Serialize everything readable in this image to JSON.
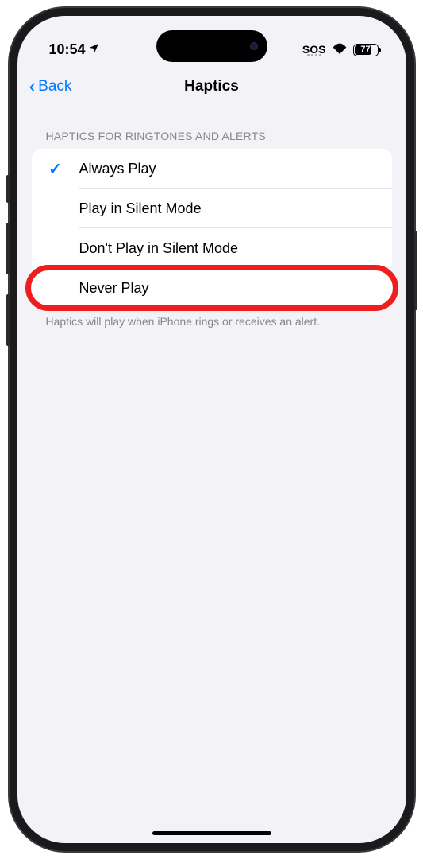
{
  "status": {
    "time": "10:54",
    "sos": "SOS",
    "battery": "77"
  },
  "nav": {
    "back": "Back",
    "title": "Haptics"
  },
  "section": {
    "header": "HAPTICS FOR RINGTONES AND ALERTS",
    "footer": "Haptics will play when iPhone rings or receives an alert."
  },
  "options": {
    "always": "Always Play",
    "silent": "Play in Silent Mode",
    "nosilent": "Don't Play in Silent Mode",
    "never": "Never Play"
  }
}
